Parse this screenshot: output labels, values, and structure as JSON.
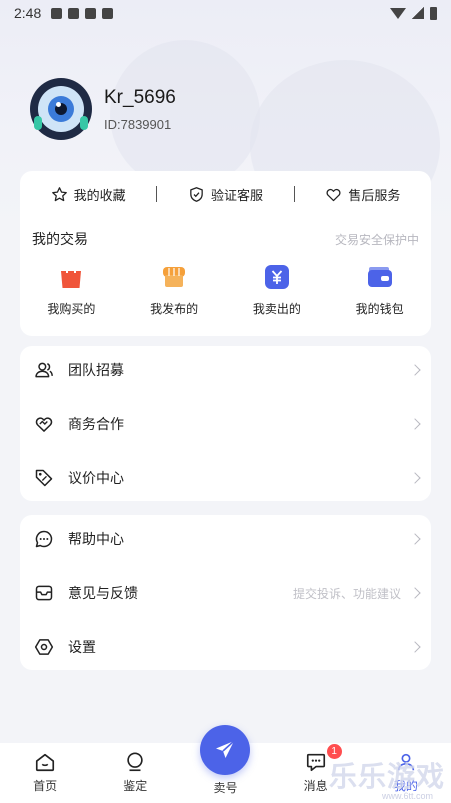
{
  "status_bar": {
    "time": "2:48"
  },
  "profile": {
    "username": "Kr_5696",
    "user_id": "ID:7839901"
  },
  "quick_links": [
    {
      "label": "我的收藏",
      "icon": "star-icon"
    },
    {
      "label": "验证客服",
      "icon": "shield-check-icon"
    },
    {
      "label": "售后服务",
      "icon": "heart-icon"
    }
  ],
  "trade": {
    "title": "我的交易",
    "note": "交易安全保护中",
    "items": [
      {
        "label": "我购买的",
        "icon": "shopping-bag-icon",
        "color": "#f0553a"
      },
      {
        "label": "我发布的",
        "icon": "store-icon",
        "color": "#f5a03a"
      },
      {
        "label": "我卖出的",
        "icon": "yuan-icon",
        "color": "#4c63e8"
      },
      {
        "label": "我的钱包",
        "icon": "wallet-icon",
        "color": "#4c63e8"
      }
    ]
  },
  "menu_group_1": [
    {
      "label": "团队招募",
      "icon": "users-icon"
    },
    {
      "label": "商务合作",
      "icon": "handshake-icon"
    },
    {
      "label": "议价中心",
      "icon": "price-tag-icon"
    }
  ],
  "menu_group_2": [
    {
      "label": "帮助中心",
      "icon": "chat-bubble-icon",
      "hint": ""
    },
    {
      "label": "意见与反馈",
      "icon": "inbox-icon",
      "hint": "提交投诉、功能建议"
    },
    {
      "label": "设置",
      "icon": "hexagon-gear-icon",
      "hint": ""
    }
  ],
  "tabbar": [
    {
      "label": "首页",
      "icon": "home-icon"
    },
    {
      "label": "鉴定",
      "icon": "appraisal-icon"
    },
    {
      "label": "卖号",
      "icon": "send-icon"
    },
    {
      "label": "消息",
      "icon": "message-icon",
      "badge": "1"
    },
    {
      "label": "我的",
      "icon": "profile-icon"
    }
  ],
  "watermark": {
    "text": "乐乐游戏",
    "sub": "www.6tt.com"
  },
  "colors": {
    "accent": "#4c63e8",
    "badge": "#ff4d4f"
  }
}
